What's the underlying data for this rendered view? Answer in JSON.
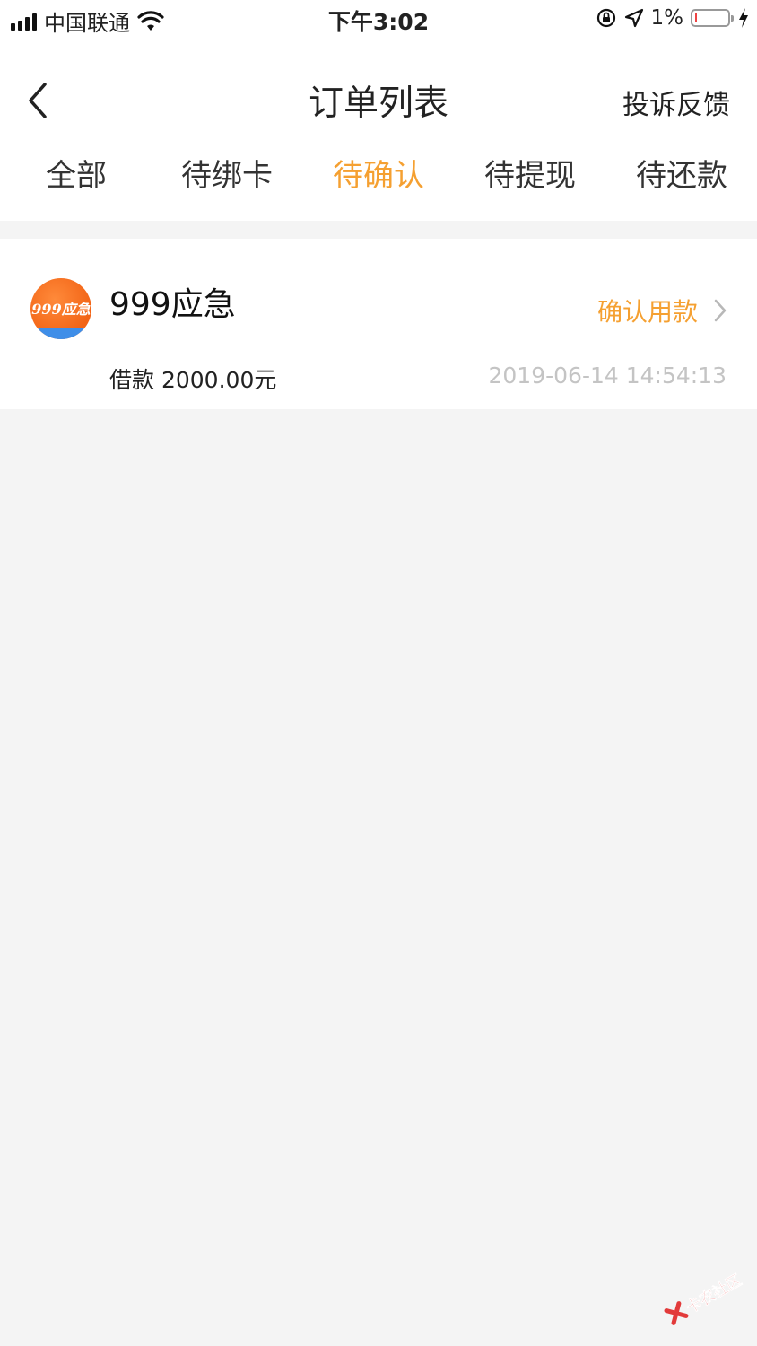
{
  "status_bar": {
    "carrier": "中国联通",
    "time": "下午3:02",
    "battery_percent": "1%",
    "battery_level": 0.01,
    "icons": [
      "signal-icon",
      "wifi-icon",
      "rotation-lock-icon",
      "location-icon",
      "battery-icon",
      "charging-icon"
    ]
  },
  "nav": {
    "title": "订单列表",
    "feedback_label": "投诉反馈",
    "back_icon": "chevron-left-icon"
  },
  "tabs": [
    {
      "label": "全部",
      "active": false
    },
    {
      "label": "待绑卡",
      "active": false
    },
    {
      "label": "待确认",
      "active": true
    },
    {
      "label": "待提现",
      "active": false
    },
    {
      "label": "待还款",
      "active": false
    }
  ],
  "orders": [
    {
      "logo_text": "999应急",
      "name": "999应急",
      "action_label": "确认用款",
      "loan_label": "借款",
      "loan_amount": "2000.00元",
      "timestamp": "2019-06-14 14:54:13"
    }
  ],
  "watermark": {
    "text": "卡农社区"
  },
  "colors": {
    "accent": "#f5a031",
    "background": "#f4f4f4",
    "card": "#ffffff",
    "muted_text": "#c4c4c4"
  }
}
